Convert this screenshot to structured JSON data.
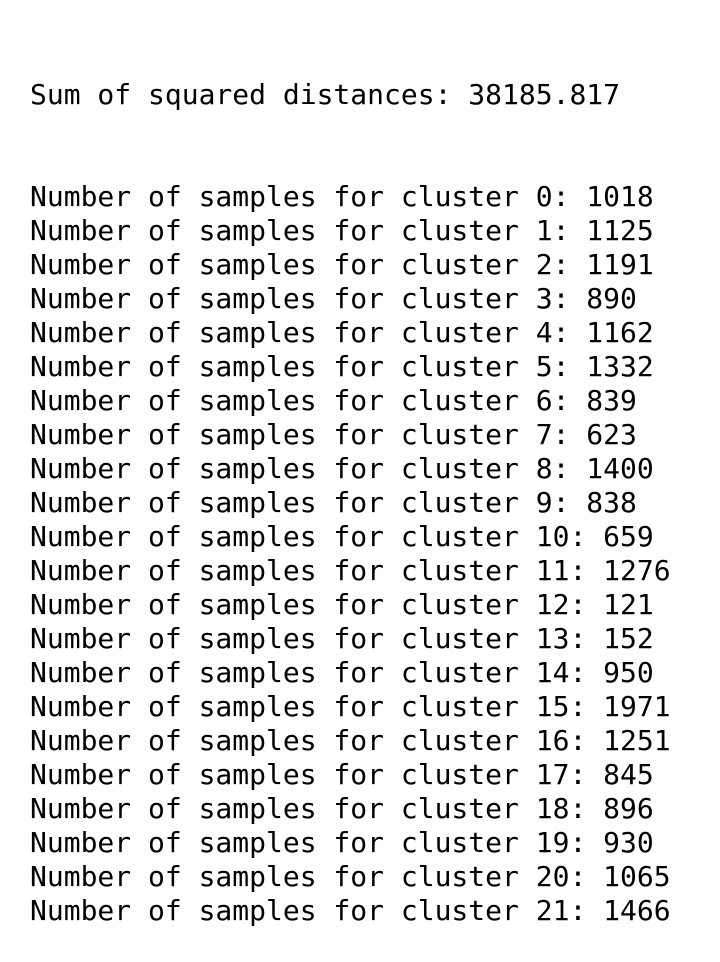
{
  "output": {
    "summary_label": "Sum of squared distances:",
    "summary_value": "38185.817",
    "cluster_lines": [
      {
        "prefix": "Number of samples for cluster 0:",
        "value": "1018"
      },
      {
        "prefix": "Number of samples for cluster 1:",
        "value": "1125"
      },
      {
        "prefix": "Number of samples for cluster 2:",
        "value": "1191"
      },
      {
        "prefix": "Number of samples for cluster 3:",
        "value": "890"
      },
      {
        "prefix": "Number of samples for cluster 4:",
        "value": "1162"
      },
      {
        "prefix": "Number of samples for cluster 5:",
        "value": "1332"
      },
      {
        "prefix": "Number of samples for cluster 6:",
        "value": "839"
      },
      {
        "prefix": "Number of samples for cluster 7:",
        "value": "623"
      },
      {
        "prefix": "Number of samples for cluster 8:",
        "value": "1400"
      },
      {
        "prefix": "Number of samples for cluster 9:",
        "value": "838"
      },
      {
        "prefix": "Number of samples for cluster 10:",
        "value": "659"
      },
      {
        "prefix": "Number of samples for cluster 11:",
        "value": "1276"
      },
      {
        "prefix": "Number of samples for cluster 12:",
        "value": "121"
      },
      {
        "prefix": "Number of samples for cluster 13:",
        "value": "152"
      },
      {
        "prefix": "Number of samples for cluster 14:",
        "value": "950"
      },
      {
        "prefix": "Number of samples for cluster 15:",
        "value": "1971"
      },
      {
        "prefix": "Number of samples for cluster 16:",
        "value": "1251"
      },
      {
        "prefix": "Number of samples for cluster 17:",
        "value": "845"
      },
      {
        "prefix": "Number of samples for cluster 18:",
        "value": "896"
      },
      {
        "prefix": "Number of samples for cluster 19:",
        "value": "930"
      },
      {
        "prefix": "Number of samples for cluster 20:",
        "value": "1065"
      },
      {
        "prefix": "Number of samples for cluster 21:",
        "value": "1466"
      }
    ]
  }
}
